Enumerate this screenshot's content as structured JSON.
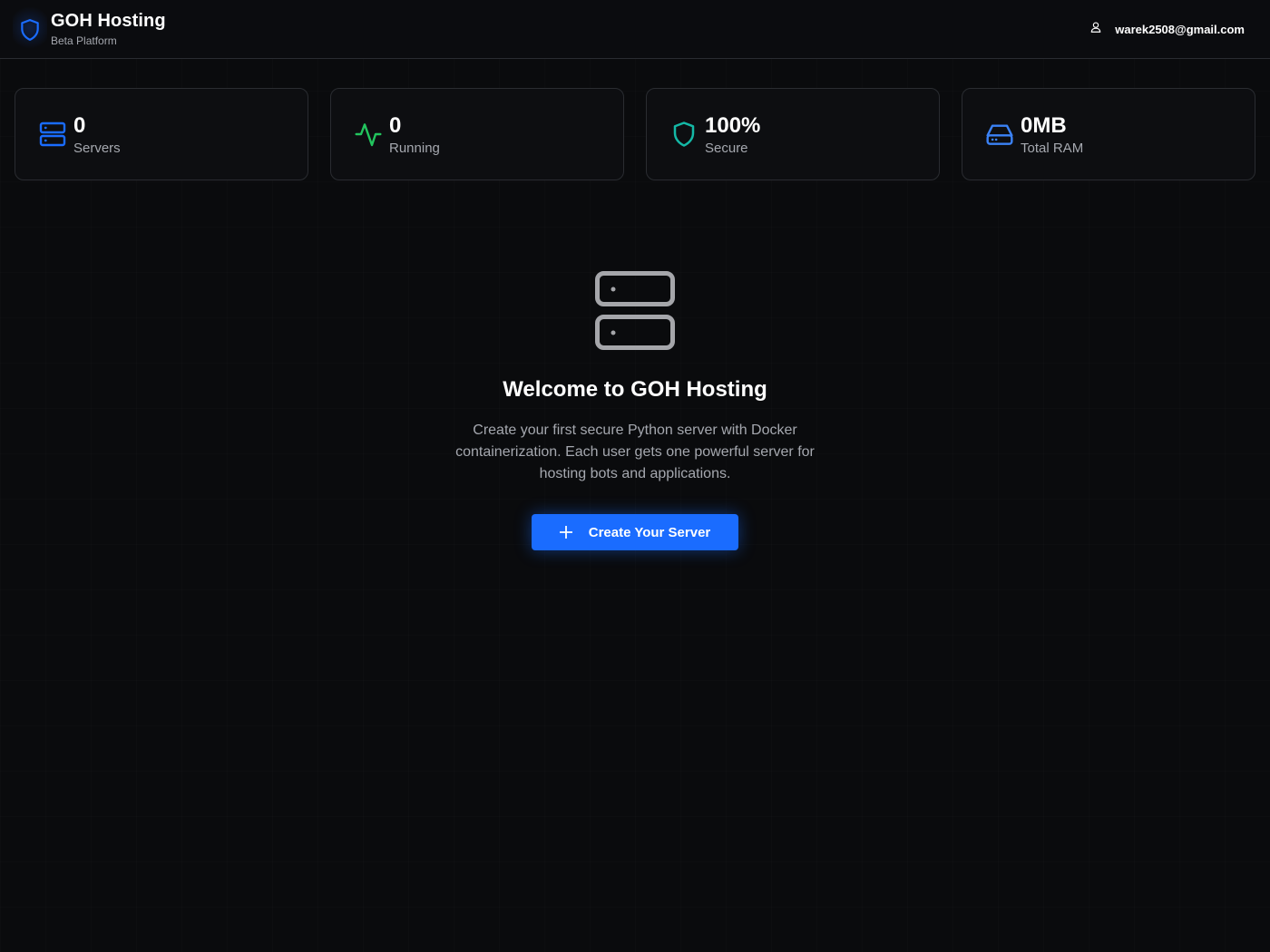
{
  "header": {
    "title": "GOH Hosting",
    "subtitle": "Beta Platform",
    "user_email": "warek2508@gmail.com",
    "icons": {
      "brand": "shield-icon",
      "user": "user-icon"
    }
  },
  "stats": [
    {
      "value": "0",
      "label": "Servers",
      "icon": "server-icon",
      "color": "#1a6cff"
    },
    {
      "value": "0",
      "label": "Running",
      "icon": "activity-icon",
      "color": "#22c55e"
    },
    {
      "value": "100%",
      "label": "Secure",
      "icon": "shield-icon",
      "color": "#14b8a6"
    },
    {
      "value": "0MB",
      "label": "Total RAM",
      "icon": "hard-drive-icon",
      "color": "#3b82f6"
    }
  ],
  "hero": {
    "title": "Welcome to GOH Hosting",
    "description": "Create your first secure Python server with Docker containerization. Each user gets one powerful server for hosting bots and applications.",
    "button_label": "Create Your Server",
    "icon": "server-icon"
  },
  "colors": {
    "background": "#0a0b0d",
    "accent": "#1a6cff",
    "muted_text": "#a5a8af",
    "border": "#2a2c31"
  }
}
